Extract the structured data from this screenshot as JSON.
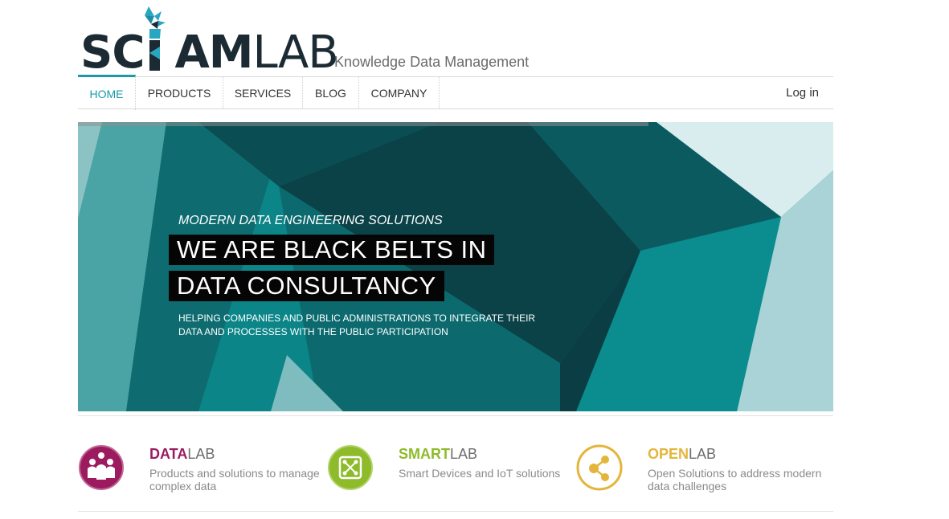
{
  "header": {
    "logo_bold": "SC",
    "logo_bold2": "AM",
    "logo_light": "LAB",
    "tagline": "Knowledge Data Management"
  },
  "nav": {
    "items": [
      {
        "label": "HOME",
        "active": true
      },
      {
        "label": "PRODUCTS"
      },
      {
        "label": "SERVICES"
      },
      {
        "label": "BLOG"
      },
      {
        "label": "COMPANY"
      }
    ],
    "login": "Log in"
  },
  "hero": {
    "kicker": "MODERN DATA ENGINEERING SOLUTIONS",
    "headline_1": "WE ARE BLACK BELTS IN",
    "headline_2": "DATA CONSULTANCY",
    "subtitle": "HELPING COMPANIES AND PUBLIC ADMINISTRATIONS TO INTEGRATE THEIR DATA AND PROCESSES WITH THE PUBLIC PARTICIPATION"
  },
  "features": [
    {
      "bold": "DATA",
      "light": "LAB",
      "desc": "Products and solutions to manage complex data",
      "color": "#9c1b5f",
      "icon": "people-icon"
    },
    {
      "bold": "SMART",
      "light": "LAB",
      "desc": "Smart Devices and IoT solutions",
      "color": "#8dbb2a",
      "icon": "circuit-icon"
    },
    {
      "bold": "OPEN",
      "light": "LAB",
      "desc": "Open Solutions to address modern data challenges",
      "color": "#e3b53a",
      "icon": "share-icon"
    }
  ],
  "colors": {
    "accent": "#1b9aa8",
    "logo_dark": "#1c2b33"
  }
}
